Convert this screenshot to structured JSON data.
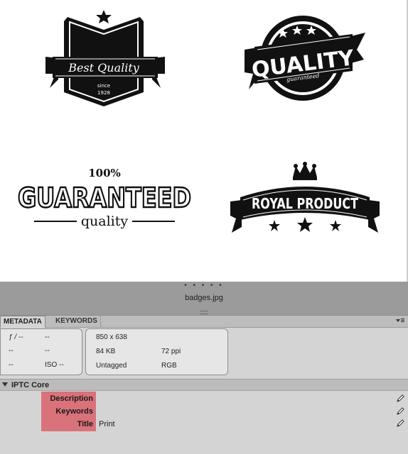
{
  "preview": {
    "badges": [
      {
        "name": "best-quality-badge",
        "line1": "Best Quality",
        "line2": "since",
        "line3": "1928"
      },
      {
        "name": "quality-guaranteed-badge",
        "line1": "QUALITY",
        "line2": "guaranteed"
      },
      {
        "name": "guaranteed-badge",
        "line1": "100%",
        "line2": "GUARANTEED",
        "line3": "quality"
      },
      {
        "name": "royal-product-badge",
        "line1": "ROYAL PRODUCT"
      }
    ],
    "filename": "badges.jpg",
    "dots": "• • • • •"
  },
  "tabs": [
    {
      "label": "METADATA",
      "active": true
    },
    {
      "label": "KEYWORDS",
      "active": false
    }
  ],
  "panel_menu_icon": "panel-menu-icon",
  "camera": {
    "f_label": "ƒ / --",
    "shutter": "--",
    "r2c1": "--",
    "r2c2": "--",
    "r3c1": "--",
    "iso": "ISO --"
  },
  "file_info": {
    "dimensions": "850 x 638",
    "size": "84 KB",
    "resolution": "72 ppi",
    "color_profile": "Untagged",
    "color_mode": "RGB"
  },
  "iptc": {
    "title": "IPTC Core",
    "fields": [
      {
        "label": "Description",
        "value": ""
      },
      {
        "label": "Keywords",
        "value": ""
      },
      {
        "label": "Title",
        "value": "Print"
      }
    ]
  },
  "colors": {
    "highlight": "#d9727a",
    "panel_bg": "#d4d4d4",
    "preview_bar": "#9b9b9b"
  }
}
